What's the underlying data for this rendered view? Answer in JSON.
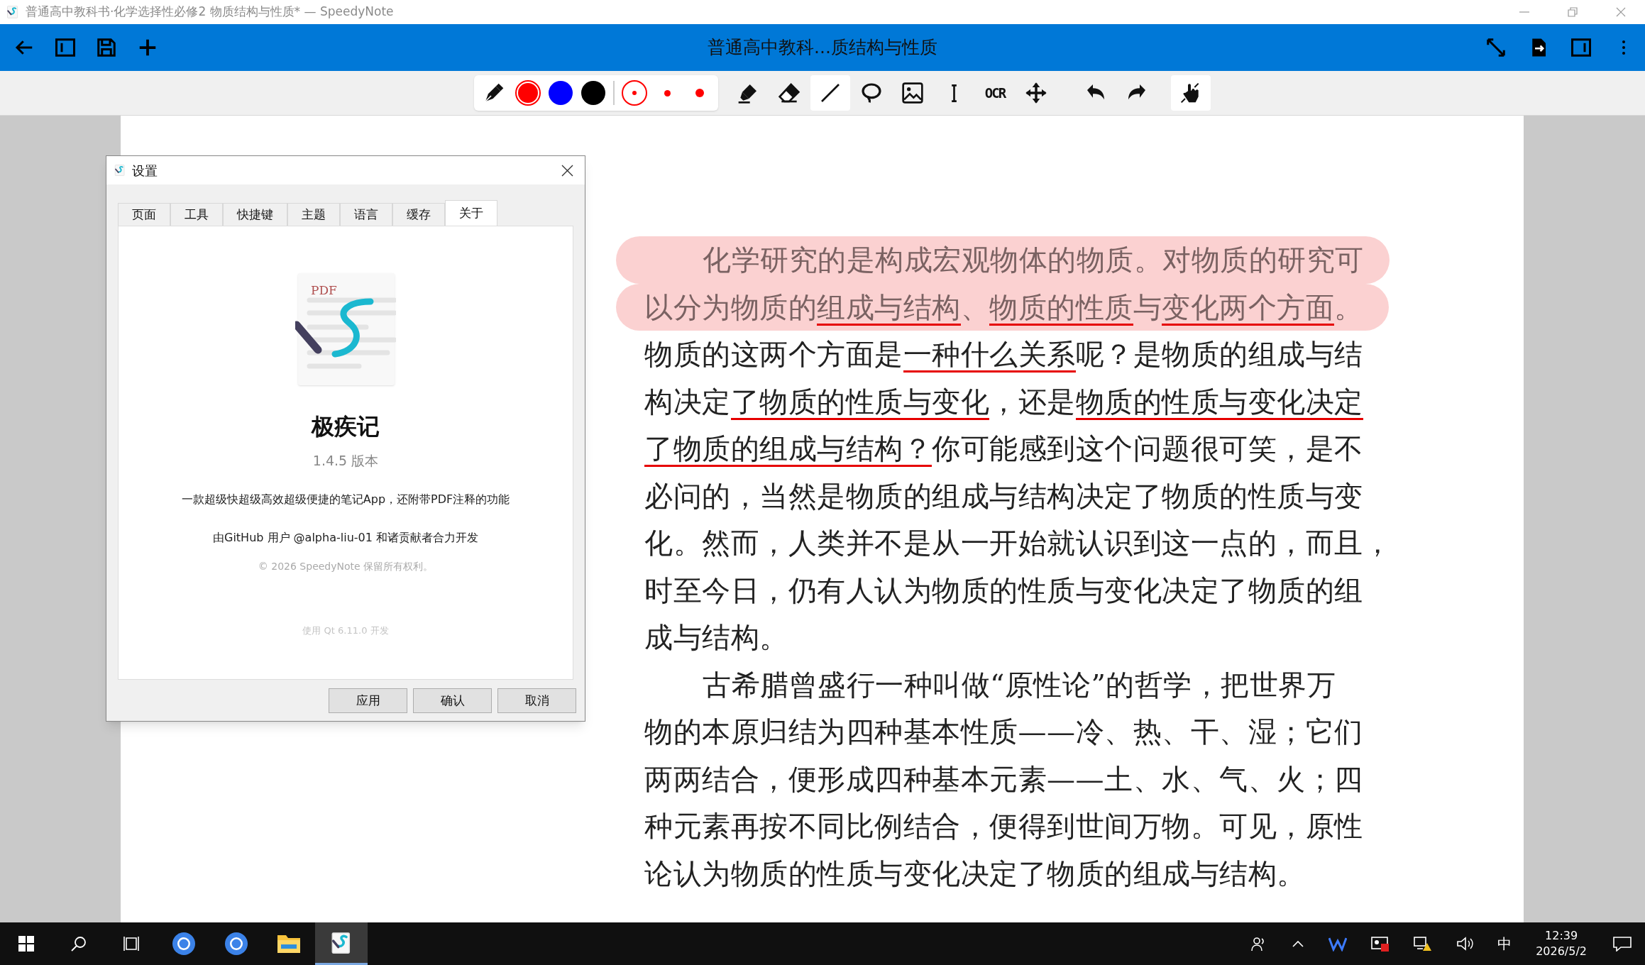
{
  "window": {
    "title": "普通高中教科书·化学选择性必修2 物质结构与性质* — SpeedyNote"
  },
  "app_bar": {
    "title": "普通高中教科...质结构与性质"
  },
  "toolbar": {
    "pen": {
      "selected": false
    },
    "colors": [
      {
        "color": "#ff0000",
        "selected": true
      },
      {
        "color": "#0000ff",
        "selected": false
      },
      {
        "color": "#000000",
        "selected": false
      }
    ],
    "sizes": [
      {
        "selected": true
      },
      {
        "selected": false
      },
      {
        "selected": false
      }
    ],
    "tools": [
      {
        "kind": "highlighter",
        "selected": false
      },
      {
        "kind": "eraser",
        "selected": false
      },
      {
        "kind": "line",
        "selected": true
      },
      {
        "kind": "lasso",
        "selected": false
      },
      {
        "kind": "image",
        "selected": false
      },
      {
        "kind": "text",
        "selected": false
      },
      {
        "kind": "ocr",
        "label": "OCR",
        "selected": false
      },
      {
        "kind": "move",
        "selected": false
      },
      {
        "kind": "undo",
        "selected": false
      },
      {
        "kind": "redo",
        "selected": false
      },
      {
        "kind": "touch",
        "selected": true
      }
    ]
  },
  "document": {
    "lines": [
      {
        "indent": true,
        "highlighted": true,
        "segments": [
          {
            "text": "化学研究的是构成宏观物体的物质。对物质的研究可",
            "underlined": false
          }
        ]
      },
      {
        "indent": false,
        "highlighted": true,
        "segments": [
          {
            "text": "以分为物质的",
            "underlined": false
          },
          {
            "text": "组成与结构",
            "underlined": true
          },
          {
            "text": "、",
            "underlined": false
          },
          {
            "text": "物质的性质",
            "underlined": true
          },
          {
            "text": "与",
            "underlined": false
          },
          {
            "text": "变化两个方面",
            "underlined": true
          },
          {
            "text": "。",
            "underlined": false
          }
        ]
      },
      {
        "indent": false,
        "highlighted": false,
        "segments": [
          {
            "text": "物质的这两个方面是",
            "underlined": false
          },
          {
            "text": "一种什么关系",
            "underlined": true
          },
          {
            "text": "呢？是物质的组成与结",
            "underlined": false
          }
        ]
      },
      {
        "indent": false,
        "highlighted": false,
        "segments": [
          {
            "text": "构决定",
            "underlined": false
          },
          {
            "text": "了物质的性质与变化",
            "underlined": true
          },
          {
            "text": "，还是",
            "underlined": false
          },
          {
            "text": "物质的性质与变化决定",
            "underlined": true
          }
        ]
      },
      {
        "indent": false,
        "highlighted": false,
        "segments": [
          {
            "text": "了物质的组成与结构？",
            "underlined": true
          },
          {
            "text": "你可能感到这个问题很可笑，是不",
            "underlined": false
          }
        ]
      },
      {
        "indent": false,
        "highlighted": false,
        "segments": [
          {
            "text": "必问的，当然是物质的组成与结构决定了物质的性质与变",
            "underlined": false
          }
        ]
      },
      {
        "indent": false,
        "highlighted": false,
        "segments": [
          {
            "text": "化。然而，人类并不是从一开始就认识到这一点的，而且，",
            "underlined": false
          }
        ]
      },
      {
        "indent": false,
        "highlighted": false,
        "segments": [
          {
            "text": "时至今日，仍有人认为物质的性质与变化决定了物质的组",
            "underlined": false
          }
        ]
      },
      {
        "indent": false,
        "highlighted": false,
        "segments": [
          {
            "text": "成与结构。",
            "underlined": false
          }
        ]
      },
      {
        "indent": true,
        "highlighted": false,
        "segments": [
          {
            "text": "古希腊曾盛行一种叫做“原性论”的哲学，把世界万",
            "underlined": false
          }
        ]
      },
      {
        "indent": false,
        "highlighted": false,
        "segments": [
          {
            "text": "物的本原归结为四种基本性质——冷、热、干、湿；它们",
            "underlined": false
          }
        ]
      },
      {
        "indent": false,
        "highlighted": false,
        "segments": [
          {
            "text": "两两结合，便形成四种基本元素——土、水、气、火；四",
            "underlined": false
          }
        ]
      },
      {
        "indent": false,
        "highlighted": false,
        "segments": [
          {
            "text": "种元素再按不同比例结合，便得到世间万物。可见，原性",
            "underlined": false
          }
        ]
      },
      {
        "indent": false,
        "highlighted": false,
        "segments": [
          {
            "text": "论认为物质的性质与变化决定了物质的组成与结构。",
            "underlined": false
          }
        ]
      }
    ]
  },
  "dialog": {
    "title": "设置",
    "tabs": [
      {
        "label": "页面",
        "selected": false
      },
      {
        "label": "工具",
        "selected": false
      },
      {
        "label": "快捷键",
        "selected": false
      },
      {
        "label": "主题",
        "selected": false
      },
      {
        "label": "语言",
        "selected": false
      },
      {
        "label": "缓存",
        "selected": false
      },
      {
        "label": "关于",
        "selected": true
      }
    ],
    "about": {
      "logo_label": "PDF",
      "name": "极疾记",
      "version": "1.4.5 版本",
      "description": "一款超级快超级高效超级便捷的笔记App，还附带PDF注释的功能",
      "credit": "由GitHub 用户 @alpha-liu-01 和诸贡献者合力开发",
      "copyright": "© 2026 SpeedyNote 保留所有权利。",
      "built_with": "使用 Qt 6.11.0 开发"
    },
    "buttons": [
      "应用",
      "确认",
      "取消"
    ]
  },
  "taskbar": {
    "apps": [
      {
        "kind": "browser",
        "active": false
      },
      {
        "kind": "browser",
        "active": false
      },
      {
        "kind": "folder",
        "active": false
      },
      {
        "kind": "notes",
        "active": true
      }
    ],
    "tray": {
      "ime": "中",
      "time": "12:39",
      "date": "2026/5/2"
    }
  }
}
